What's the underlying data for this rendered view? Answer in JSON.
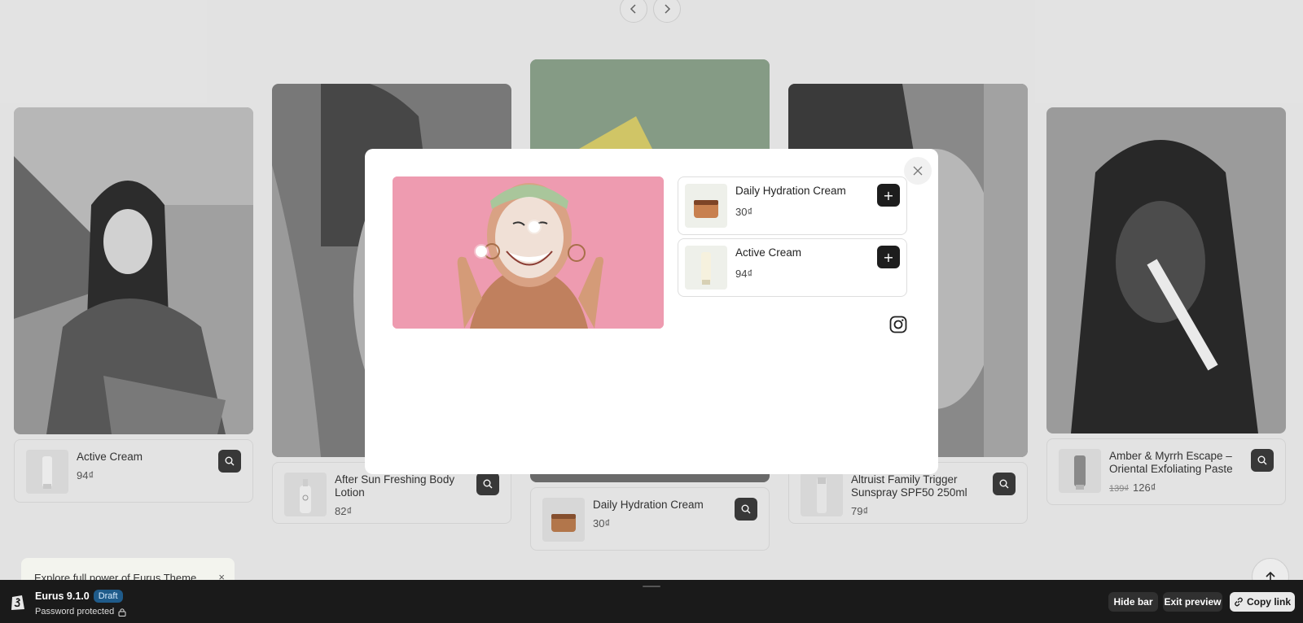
{
  "cards": [
    {
      "name": "Active Cream",
      "price": "94₫"
    },
    {
      "name": "After Sun Freshing Body Lotion",
      "price": "82₫"
    },
    {
      "name": "Daily Hydration Cream",
      "price": "30₫"
    },
    {
      "name": "Altruist Family Trigger Sunspray SPF50 250ml",
      "price": "79₫"
    },
    {
      "name": "Amber & Myrrh Escape – Oriental Exfoliating Paste",
      "old_price": "139₫",
      "price": "126₫"
    }
  ],
  "modal": {
    "items": [
      {
        "name": "Daily Hydration Cream",
        "price": "30₫"
      },
      {
        "name": "Active Cream",
        "price": "94₫"
      }
    ],
    "add_label": "+",
    "icons": {
      "close": "close-icon",
      "add": "plus-icon",
      "social": "instagram-icon"
    }
  },
  "promo": {
    "text": "Explore full power of Eurus Theme",
    "close": "×"
  },
  "adminbar": {
    "theme_name": "Eurus 9.1.0",
    "badge": "Draft",
    "password": "Password protected",
    "hide_bar": "Hide bar",
    "exit_preview": "Exit preview",
    "copy_link": "Copy link"
  },
  "colors": {
    "accent_dark": "#1d1d1d",
    "badge_bg": "#1f5b8a",
    "hero_bg": "#ee9bb0",
    "admin_bar": "#1a1a1a"
  }
}
